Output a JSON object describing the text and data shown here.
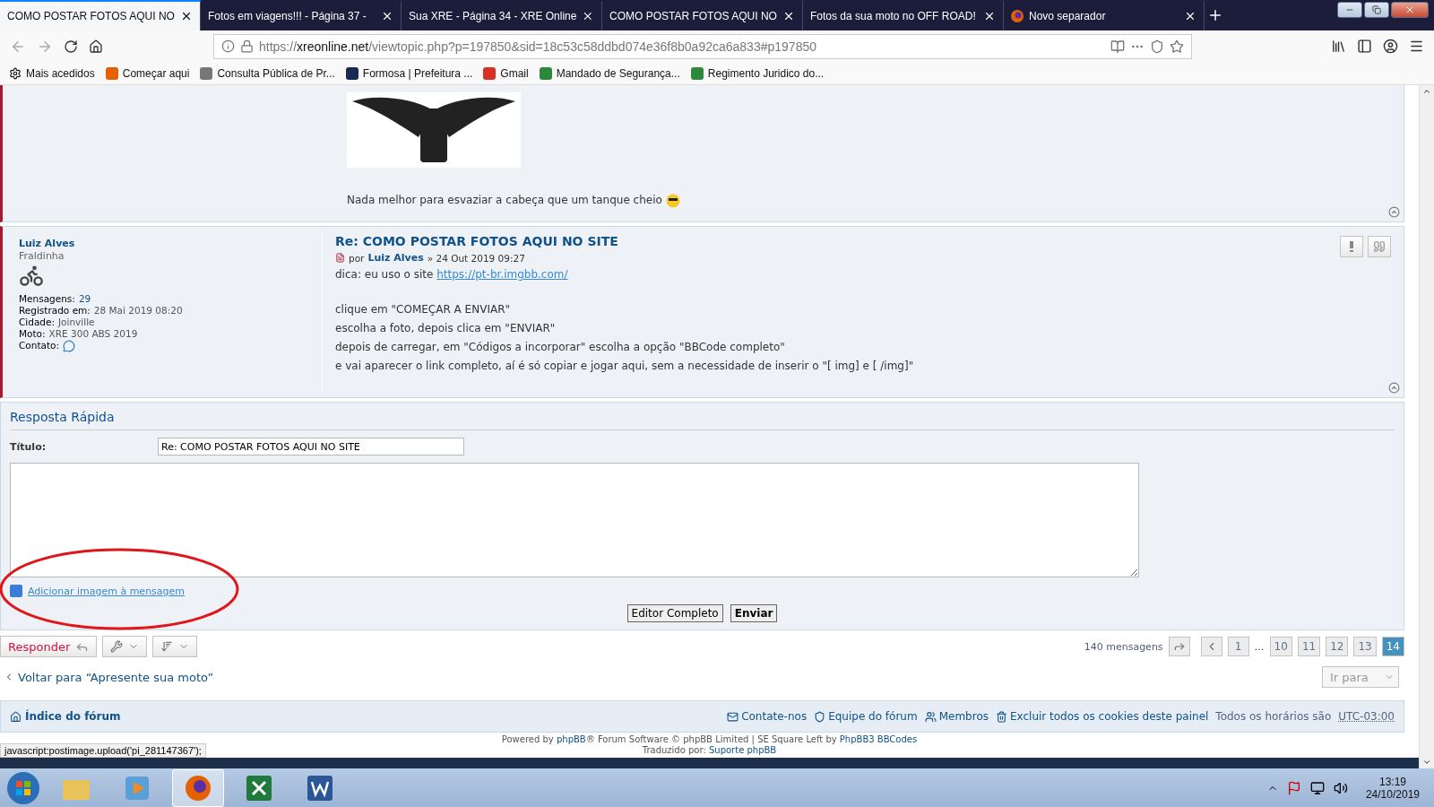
{
  "browser": {
    "tabs": [
      {
        "title": "COMO POSTAR FOTOS AQUI NO",
        "selected": true
      },
      {
        "title": "Fotos em viagens!!! - Página 37 -",
        "selected": false
      },
      {
        "title": "Sua XRE - Página 34 - XRE Online",
        "selected": false
      },
      {
        "title": "COMO POSTAR FOTOS AQUI NO",
        "selected": false
      },
      {
        "title": "Fotos da sua moto no OFF ROAD!",
        "selected": false
      },
      {
        "title": "Novo separador",
        "selected": false
      }
    ],
    "url_prefix": "https://",
    "url_domain": "xreonline.net",
    "url_path": "/viewtopic.php?p=197850&sid=18c53c58ddbd074e36f8b0a92ca6a833#p197850",
    "bookmarks": [
      "Mais acedidos",
      "Começar aqui",
      "Consulta Pública de Pr...",
      "Formosa | Prefeitura ...",
      "Gmail",
      "Mandado de Segurança...",
      "Regimento Juridico do..."
    ]
  },
  "previous_post": {
    "text": "Nada melhor para esvaziar a cabeça que um tanque cheio"
  },
  "post": {
    "author": "Luiz Alves",
    "rank": "Fraldinha",
    "profile": [
      {
        "label": "Mensagens:",
        "value": "29",
        "link": true
      },
      {
        "label": "Registrado em:",
        "value": "28 Mai 2019 08:20",
        "link": false
      },
      {
        "label": "Cidade:",
        "value": "Joinville",
        "link": false
      },
      {
        "label": "Moto:",
        "value": "XRE 300 ABS 2019",
        "link": false
      }
    ],
    "contact_label": "Contato:",
    "title": "Re: COMO POSTAR FOTOS AQUI NO SITE",
    "by": "por",
    "by_author": "Luiz Alves",
    "date": "» 24 Out 2019 09:27",
    "intro": "dica: eu uso o site",
    "link": "https://pt-br.imgbb.com/",
    "lines": [
      "clique em \"COMEÇAR A ENVIAR\"",
      "escolha a foto, depois clica em \"ENVIAR\"",
      "depois de carregar, em \"Códigos a incorporar\" escolha a opção \"BBCode completo\"",
      "e vai aparecer o link completo, aí é só copiar e jogar aqui, sem a necessidade de inserir o \"[ img] e [ /img]\""
    ]
  },
  "quick_reply": {
    "heading": "Resposta Rápida",
    "title_label": "Título:",
    "title_value": "Re: COMO POSTAR FOTOS AQUI NO SITE",
    "add_image_link": "Adicionar imagem à mensagem",
    "buttons": [
      "Editor Completo",
      "Enviar"
    ]
  },
  "actions": {
    "reply": "Responder",
    "count": "140 mensagens",
    "ellipsis": "…",
    "pages": [
      {
        "label": "1",
        "selected": false
      },
      {
        "label": "10",
        "selected": false
      },
      {
        "label": "11",
        "selected": false
      },
      {
        "label": "12",
        "selected": false
      },
      {
        "label": "13",
        "selected": false
      },
      {
        "label": "14",
        "selected": true
      }
    ]
  },
  "back_link": "Voltar para “Apresente sua moto”",
  "jump": "Ir para",
  "footer": {
    "index": "Índice do fórum",
    "links": [
      "Contate-nos",
      "Equipe do fórum",
      "Membros",
      "Excluir todos os cookies deste painel"
    ],
    "timezone_label": "Todos os horários são",
    "timezone": "UTC-03:00"
  },
  "credits": [
    [
      {
        "text": "Powered by ",
        "link": false
      },
      {
        "text": "phpBB",
        "link": true
      },
      {
        "text": "® Forum Software © phpBB Limited | SE Square Left by ",
        "link": false
      },
      {
        "text": "PhpBB3 BBCodes",
        "link": true
      }
    ],
    [
      {
        "text": "Traduzido por: ",
        "link": false
      },
      {
        "text": "Suporte phpBB",
        "link": true
      }
    ]
  ],
  "status_text": "javascript:postimage.upload('pi_281147367');",
  "taskbar": {
    "time": "13:19",
    "date": "24/10/2019"
  }
}
